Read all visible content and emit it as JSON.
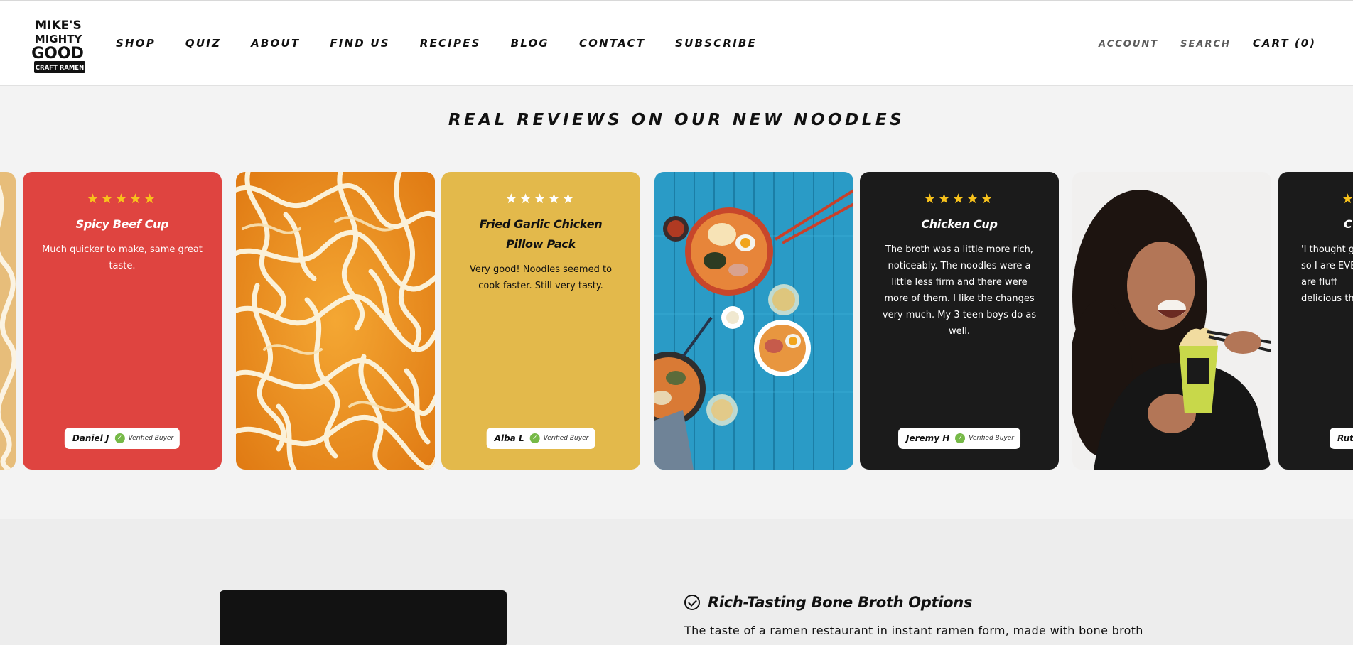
{
  "brand": {
    "logo_lines": [
      "MIKE'S",
      "MIGHTY",
      "GOOD",
      "CRAFT RAMEN"
    ]
  },
  "nav": {
    "items": [
      "SHOP",
      "QUIZ",
      "ABOUT",
      "FIND US",
      "RECIPES",
      "BLOG",
      "CONTACT",
      "SUBSCRIBE"
    ]
  },
  "utils": {
    "account": "ACCOUNT",
    "search": "SEARCH",
    "cart": "CART (0)"
  },
  "reviews": {
    "title": "REAL REVIEWS ON OUR NEW NOODLES",
    "verified_label": "Verified Buyer",
    "cards": [
      {
        "title": "Spicy Beef Cup",
        "stars": "★★★★★",
        "body": "Much quicker to make, same great taste.",
        "reviewer": "Daniel J"
      },
      {
        "title": "Fried Garlic Chicken Pillow Pack",
        "stars": "★★★★★",
        "body": "Very good! Noodles seemed to cook faster. Still very tasty.",
        "reviewer": "Alba L"
      },
      {
        "title": "Chicken Cup",
        "stars": "★★★★★",
        "body": "The broth was a little more rich, noticeably. The noodles were a little less firm and there were more of them. I like the changes very much. My 3 teen boys do as well.",
        "reviewer": "Jeremy H"
      },
      {
        "title": "C",
        "stars": "★",
        "body": "'I thought great so I are EVEN are fluff delicious th",
        "reviewer": "Ruthi"
      }
    ]
  },
  "feature": {
    "title": "Rich-Tasting Bone Broth Options",
    "text": "The taste of a ramen restaurant in instant ramen form, made with bone broth"
  },
  "colors": {
    "red_card": "#df4440",
    "yellow_card": "#e3b94b",
    "black_card": "#1b1b1b",
    "star_gold": "#f8c21c",
    "verified_green": "#76b947"
  }
}
